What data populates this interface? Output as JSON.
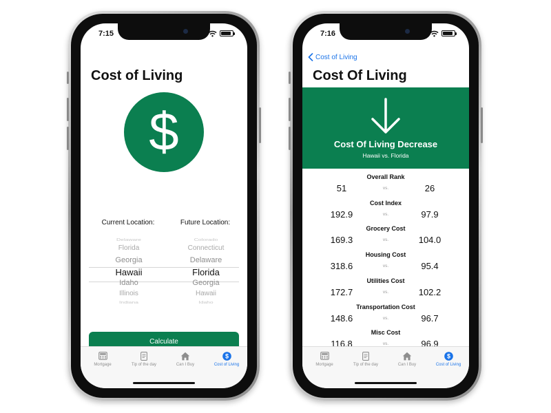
{
  "screen1": {
    "status_time": "7:15",
    "title": "Cost of Living",
    "current_label": "Current Location:",
    "future_label": "Future Location:",
    "current_picker": [
      "Delaware",
      "Florida",
      "Georgia",
      "Hawaii",
      "Idaho",
      "Illinois",
      "Indiana"
    ],
    "current_selected": "Hawaii",
    "future_picker": [
      "Colorado",
      "Connecticut",
      "Delaware",
      "Florida",
      "Georgia",
      "Hawaii",
      "Idaho"
    ],
    "future_selected": "Florida",
    "calculate_label": "Calculate"
  },
  "screen2": {
    "status_time": "7:16",
    "back_label": "Cost of Living",
    "title": "Cost Of Living",
    "banner_title": "Cost Of Living Decrease",
    "banner_subtitle": "Hawaii vs. Florida",
    "vs_label": "vs.",
    "stats": [
      {
        "label": "Overall Rank",
        "left": "51",
        "right": "26"
      },
      {
        "label": "Cost Index",
        "left": "192.9",
        "right": "97.9"
      },
      {
        "label": "Grocery Cost",
        "left": "169.3",
        "right": "104.0"
      },
      {
        "label": "Housing Cost",
        "left": "318.6",
        "right": "95.4"
      },
      {
        "label": "Utilities Cost",
        "left": "172.7",
        "right": "102.2"
      },
      {
        "label": "Transportation Cost",
        "left": "148.6",
        "right": "96.7"
      },
      {
        "label": "Misc Cost",
        "left": "116.8",
        "right": "96.9"
      }
    ]
  },
  "tabbar": {
    "items": [
      {
        "label": "Mortgage",
        "icon": "calculator-icon"
      },
      {
        "label": "Tip of the day",
        "icon": "document-icon"
      },
      {
        "label": "Can I Buy",
        "icon": "house-icon"
      },
      {
        "label": "Cost of Living",
        "icon": "dollar-icon"
      }
    ],
    "active_index": 3
  },
  "colors": {
    "accent_green": "#0b7f50",
    "link_blue": "#1a73e8"
  }
}
